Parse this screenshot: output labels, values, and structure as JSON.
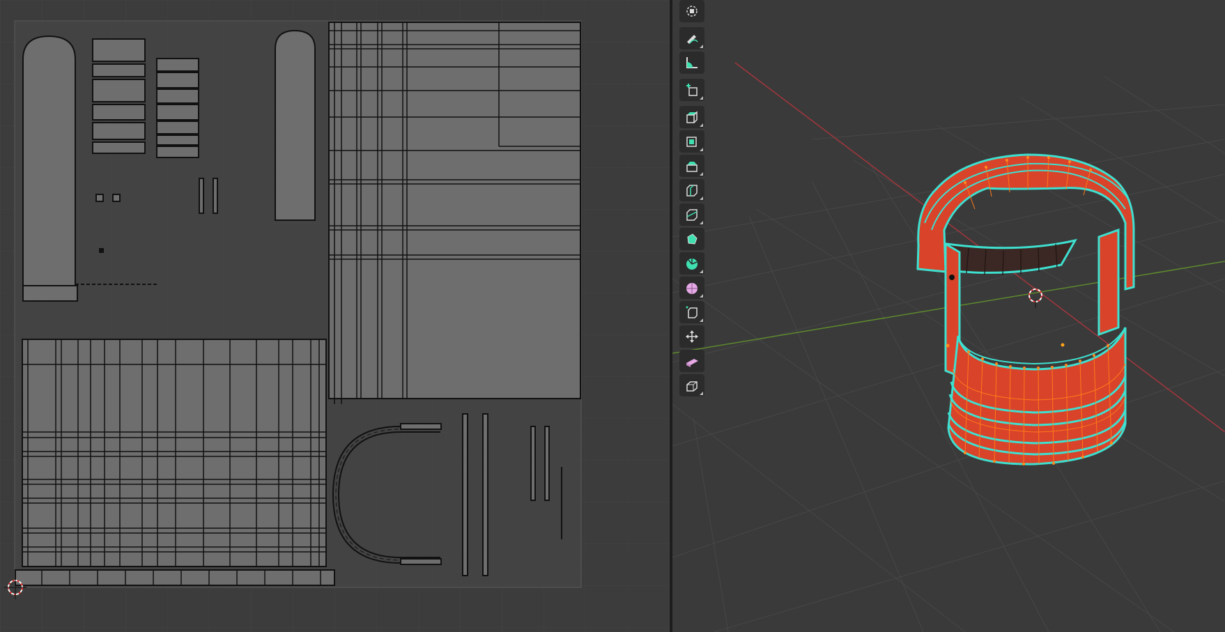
{
  "app": {
    "left_editor": "uv-editor",
    "right_editor": "3d-viewport"
  },
  "colors": {
    "panel_bg": "#3c3c3c",
    "uv_tile_bg": "#434343",
    "uv_island_fill": "#6e6e6e",
    "uv_edge": "#111111",
    "toolbar_bg": "#2b2b2b",
    "mesh_face_selected": "#d8432a",
    "mesh_edge": "#ff7a1a",
    "seam_edge": "#3ee0d0",
    "x_axis": "#a3363d",
    "y_axis": "#5e8a2d",
    "inner_shadow_band": "#3b2824"
  },
  "toolbar": {
    "tools": [
      {
        "name": "cursor-tool",
        "icon": "cursor-icon"
      },
      {
        "name": "annotate-tool",
        "icon": "annotate-icon",
        "grouped": true
      },
      {
        "name": "measure-tool",
        "icon": "measure-icon"
      },
      {
        "name": "add-cube-tool",
        "icon": "add-cube-icon",
        "grouped": true
      },
      {
        "name": "extrude-region-tool",
        "icon": "extrude-icon",
        "grouped": true
      },
      {
        "name": "inset-faces-tool",
        "icon": "inset-icon",
        "grouped": true
      },
      {
        "name": "bevel-tool",
        "icon": "bevel-icon",
        "grouped": true
      },
      {
        "name": "loop-cut-tool",
        "icon": "loop-cut-icon",
        "grouped": true
      },
      {
        "name": "knife-tool",
        "icon": "knife-icon",
        "grouped": true
      },
      {
        "name": "poly-build-tool",
        "icon": "poly-build-icon"
      },
      {
        "name": "spin-tool",
        "icon": "spin-icon",
        "grouped": true
      },
      {
        "name": "smooth-tool",
        "icon": "smooth-icon",
        "grouped": true
      },
      {
        "name": "edge-slide-tool",
        "icon": "edge-slide-icon",
        "grouped": true
      },
      {
        "name": "shrink-fatten-tool",
        "icon": "shrink-fatten-icon",
        "grouped": true
      },
      {
        "name": "shear-tool",
        "icon": "shear-icon",
        "grouped": true
      },
      {
        "name": "rip-region-tool",
        "icon": "rip-region-icon",
        "grouped": true
      }
    ]
  }
}
